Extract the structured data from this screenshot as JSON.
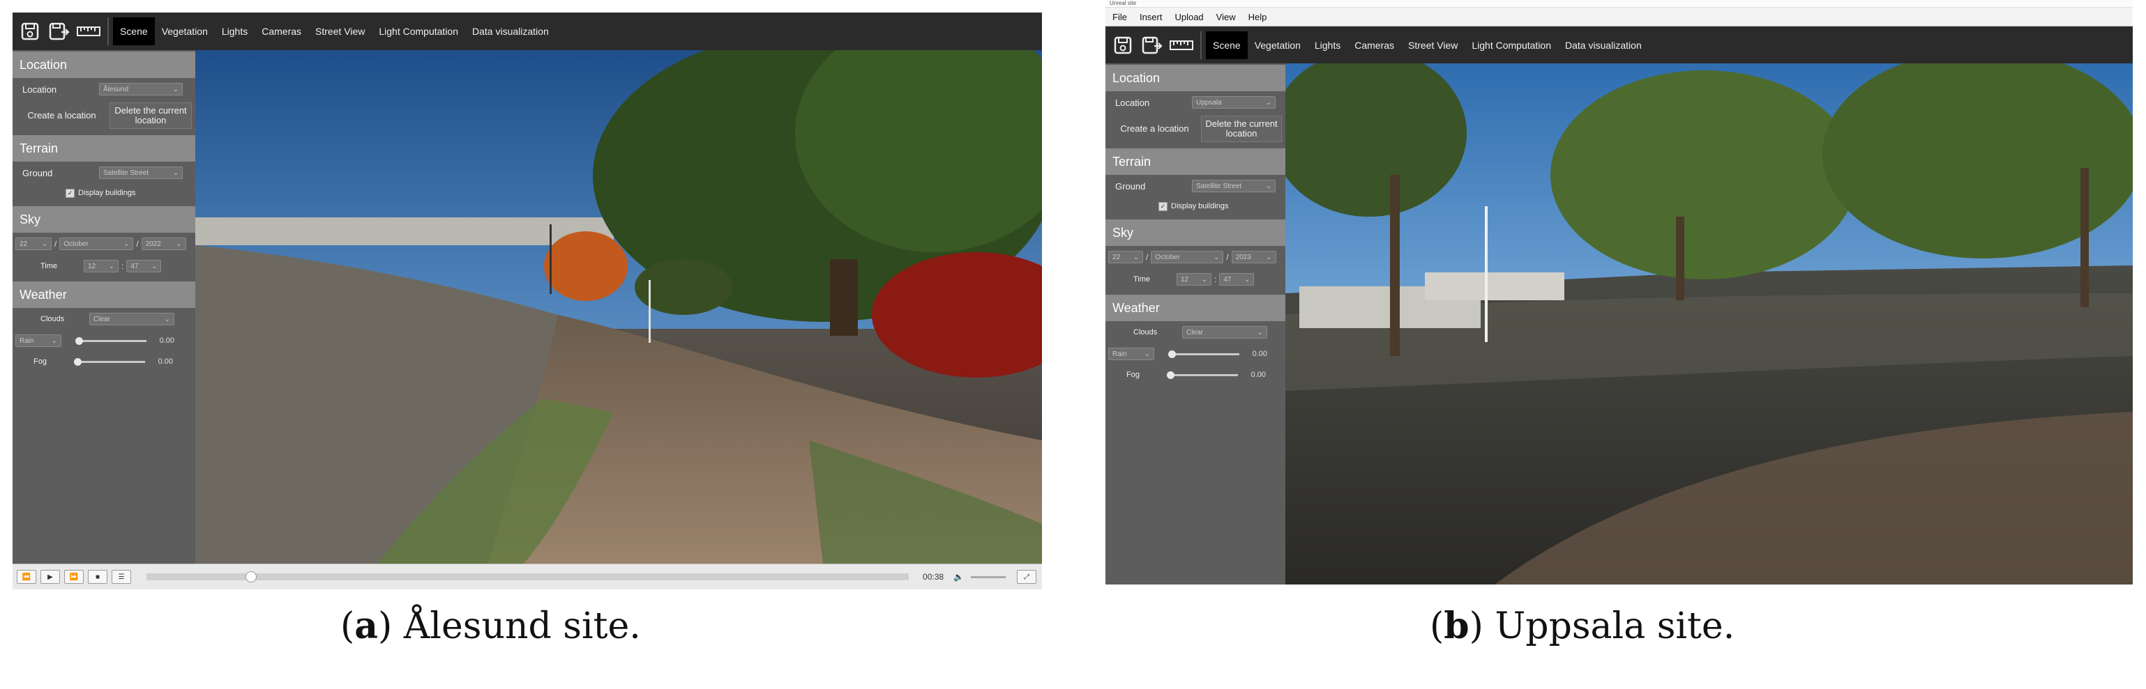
{
  "panel_a": {
    "toolbar": {
      "icons": [
        "save-icon",
        "save-as-icon",
        "ruler-icon"
      ],
      "tabs": [
        "Scene",
        "Vegetation",
        "Lights",
        "Cameras",
        "Street View",
        "Light Computation",
        "Data visualization"
      ],
      "active_tab": "Scene"
    },
    "location": {
      "header": "Location",
      "label": "Location",
      "value": "Ålesund",
      "create_button": "Create a location",
      "delete_button": "Delete the current location"
    },
    "terrain": {
      "header": "Terrain",
      "ground_label": "Ground",
      "ground_value": "Satellite Street",
      "display_buildings": "Display buildings",
      "display_buildings_checked": true
    },
    "sky": {
      "header": "Sky",
      "day": "22",
      "month": "October",
      "year": "2022",
      "date_sep": "/",
      "time_label": "Time",
      "hour": "12",
      "minute": "47",
      "time_sep": ":"
    },
    "weather": {
      "header": "Weather",
      "clouds_label": "Clouds",
      "clouds_value": "Clear",
      "rain_label": "Rain",
      "rain_value": "0.00",
      "fog_label": "Fog",
      "fog_value": "0.00"
    },
    "playbar": {
      "buttons": [
        "⏪",
        "▶",
        "⏩",
        "■",
        "☰"
      ],
      "progress": 0.13,
      "time": "00:38"
    },
    "caption_letter": "a",
    "caption_text": ") Ålesund site."
  },
  "panel_b": {
    "window_title": "Unreal site",
    "menu": [
      "File",
      "Insert",
      "Upload",
      "View",
      "Help"
    ],
    "toolbar": {
      "icons": [
        "save-icon",
        "save-as-icon",
        "ruler-icon"
      ],
      "tabs": [
        "Scene",
        "Vegetation",
        "Lights",
        "Cameras",
        "Street View",
        "Light Computation",
        "Data visualization"
      ],
      "active_tab": "Scene"
    },
    "location": {
      "header": "Location",
      "label": "Location",
      "value": "Uppsala",
      "create_button": "Create a location",
      "delete_button": "Delete the current location"
    },
    "terrain": {
      "header": "Terrain",
      "ground_label": "Ground",
      "ground_value": "Satellite Street",
      "display_buildings": "Display buildings",
      "display_buildings_checked": true
    },
    "sky": {
      "header": "Sky",
      "day": "22",
      "month": "October",
      "year": "2023",
      "date_sep": "/",
      "time_label": "Time",
      "hour": "12",
      "minute": "47",
      "time_sep": ":"
    },
    "weather": {
      "header": "Weather",
      "clouds_label": "Clouds",
      "clouds_value": "Clear",
      "rain_label": "Rain",
      "rain_value": "0.00",
      "fog_label": "Fog",
      "fog_value": "0.00"
    },
    "caption_letter": "b",
    "caption_text": ") Uppsala site."
  },
  "colors": {
    "toolbar_bg": "#2b2b2b",
    "sidebar_bg": "#5d5d5d",
    "section_header_bg": "#8b8b8b",
    "active_tab_bg": "#000000"
  }
}
